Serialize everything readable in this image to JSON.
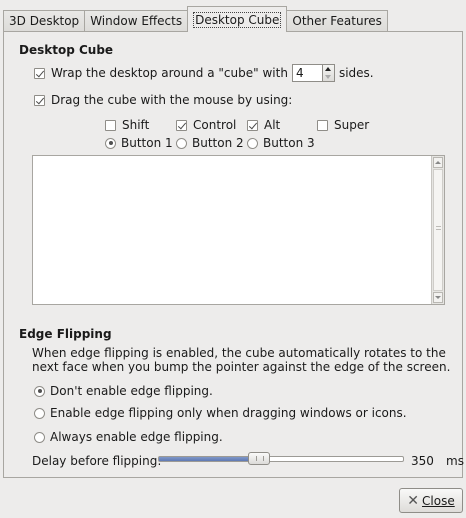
{
  "tabs": [
    {
      "label": "3D Desktop"
    },
    {
      "label": "Window Effects"
    },
    {
      "label": "Desktop Cube"
    },
    {
      "label": "Other Features"
    }
  ],
  "active_tab": "Desktop Cube",
  "cube_section": {
    "title": "Desktop Cube",
    "wrap_prefix": "Wrap the desktop around a \"cube\" with",
    "sides_value": "4",
    "wrap_suffix": "sides.",
    "wrap_checked": true,
    "drag_label": "Drag the cube with the mouse by using:",
    "drag_checked": true,
    "modifiers": [
      {
        "label": "Shift",
        "checked": false
      },
      {
        "label": "Control",
        "checked": true
      },
      {
        "label": "Alt",
        "checked": true
      },
      {
        "label": "Super",
        "checked": false
      }
    ],
    "buttons": [
      {
        "label": "Button 1",
        "selected": true
      },
      {
        "label": "Button 2",
        "selected": false
      },
      {
        "label": "Button 3",
        "selected": false
      }
    ]
  },
  "edge_section": {
    "title": "Edge Flipping",
    "description": "When edge flipping is enabled, the cube automatically rotates to the next face when you bump the pointer against the edge of the screen.",
    "options": [
      {
        "label": "Don't enable edge flipping.",
        "selected": true
      },
      {
        "label": "Enable edge flipping only when dragging windows or icons.",
        "selected": false
      },
      {
        "label": "Always enable edge flipping.",
        "selected": false
      }
    ],
    "delay_label": "Delay before flipping:",
    "delay_value": "350",
    "delay_unit": "ms",
    "delay_fraction": 0.41
  },
  "footer": {
    "close_label": "Close"
  },
  "colors": {
    "background": "#edeceb",
    "slider_fill": "#6b84bd"
  }
}
